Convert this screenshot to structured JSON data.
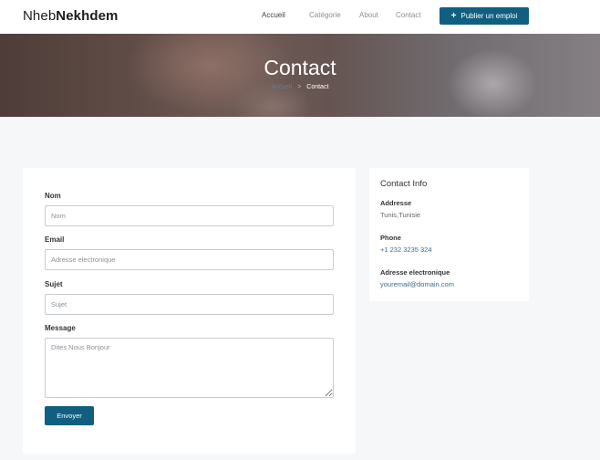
{
  "brand": {
    "light": "Nheb",
    "bold": "Nekhdem"
  },
  "nav": {
    "links": [
      "Accueil",
      "Catégorie",
      "About",
      "Contact"
    ],
    "post_button": "Publier un emploi",
    "post_icon": "plus-icon"
  },
  "hero": {
    "title": "Contact",
    "breadcrumb_home": "Accueil",
    "breadcrumb_sep": ">",
    "breadcrumb_current": "Contact"
  },
  "form": {
    "name_label": "Nom",
    "name_placeholder": "Nom",
    "email_label": "Email",
    "email_placeholder": "Adresse electronique",
    "subject_label": "Sujet",
    "subject_placeholder": "Sujet",
    "message_label": "Message",
    "message_placeholder": "Dites Nous Bonjour",
    "submit_label": "Envoyer"
  },
  "contact_info": {
    "title": "Contact Info",
    "address_label": "Addresse",
    "address_value": "Tunis,Tunisie",
    "phone_label": "Phone",
    "phone_value": "+1 232 3235 324",
    "email_label": "Adresse electronique",
    "email_value": "youremail@domain.com"
  },
  "colors": {
    "accent": "#115f80",
    "link": "#3f6d8d",
    "background": "#f6f7f9"
  }
}
